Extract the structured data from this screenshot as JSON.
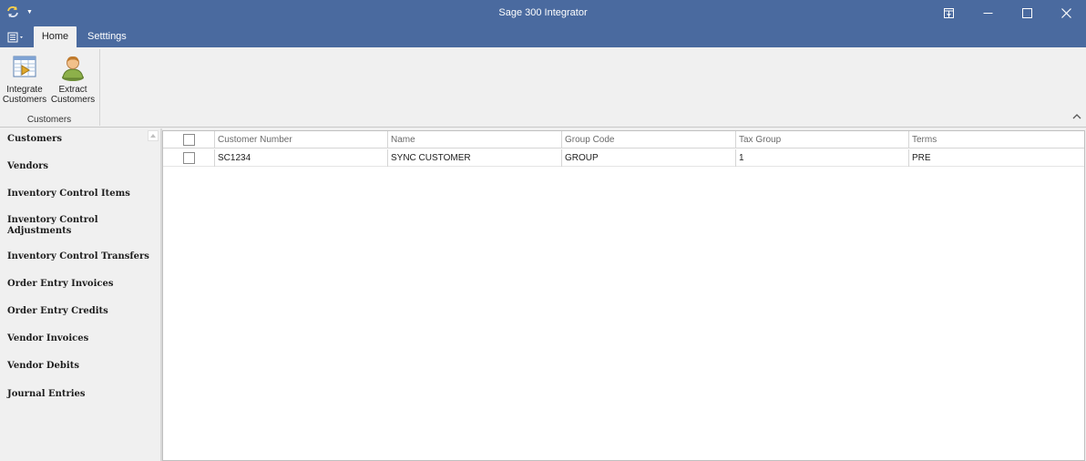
{
  "window": {
    "title": "Sage 300 Integrator",
    "colors": {
      "titlebar": "#4a6a9f",
      "ribbon": "#f0f0f0"
    }
  },
  "quick_access": {
    "icons": [
      "sync-icon",
      "chevron-down-icon"
    ]
  },
  "ribbon": {
    "tabs": [
      {
        "label": "Home",
        "active": true
      },
      {
        "label": "Setttings",
        "active": false
      }
    ],
    "groups": [
      {
        "label": "Customers",
        "buttons": [
          {
            "line1": "Integrate",
            "line2": "Customers",
            "icon": "integrate-customers-icon"
          },
          {
            "line1": "Extract",
            "line2": "Customers",
            "icon": "user-icon"
          }
        ]
      }
    ]
  },
  "nav": {
    "items": [
      {
        "label": "Customers"
      },
      {
        "label": "Vendors"
      },
      {
        "label": "Inventory Control Items"
      },
      {
        "label": "Inventory Control Adjustments"
      },
      {
        "label": "Inventory Control Transfers"
      },
      {
        "label": "Order Entry Invoices"
      },
      {
        "label": "Order Entry Credits"
      },
      {
        "label": "Vendor Invoices"
      },
      {
        "label": "Vendor Debits"
      },
      {
        "label": "Journal Entries"
      }
    ]
  },
  "grid": {
    "columns": [
      "",
      "Customer Number",
      "Name",
      "Group Code",
      "Tax Group",
      "Terms"
    ],
    "rows": [
      {
        "checked": false,
        "customer_number": "SC1234",
        "name": "SYNC CUSTOMER",
        "group_code": "GROUP",
        "tax_group": "1",
        "terms": "PRE"
      }
    ]
  }
}
